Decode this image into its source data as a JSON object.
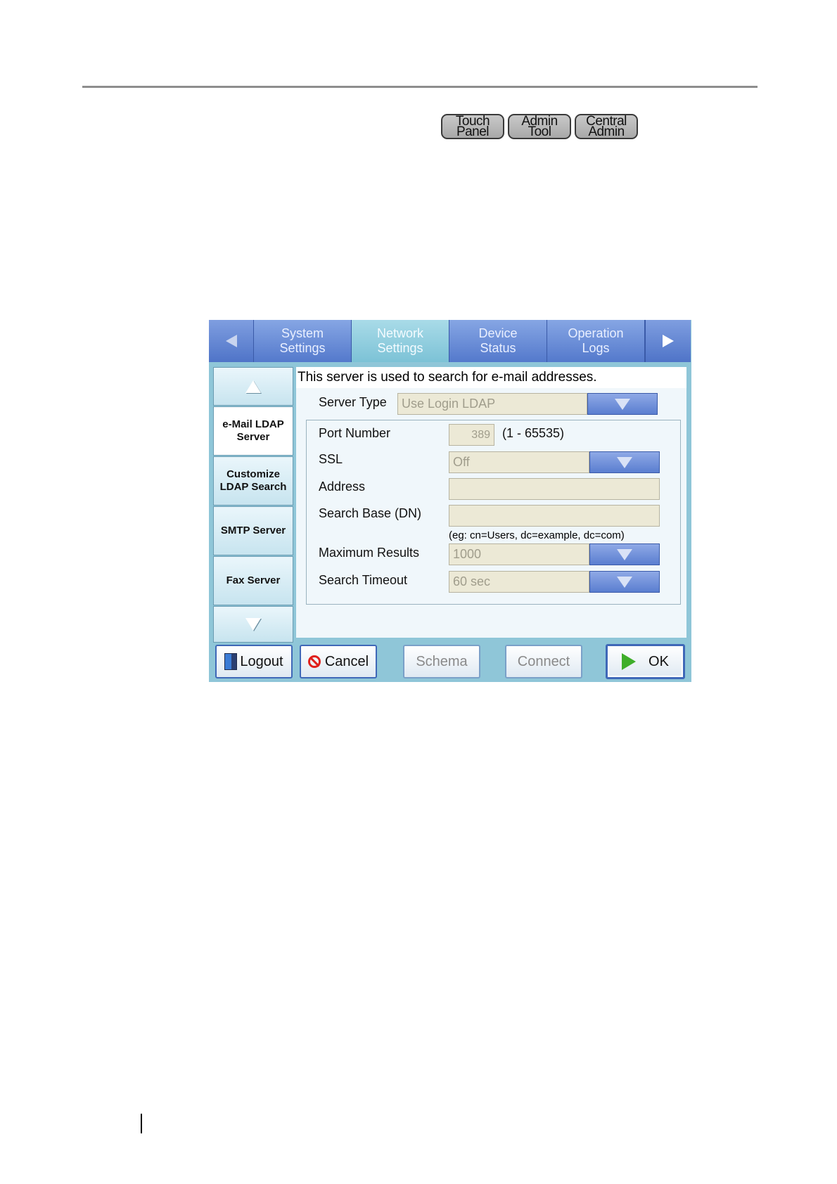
{
  "badges": [
    {
      "line1": "Touch",
      "line2": "Panel"
    },
    {
      "line1": "Admin",
      "line2": "Tool"
    },
    {
      "line1": "Central",
      "line2": "Admin"
    }
  ],
  "tabs": [
    {
      "line1": "System",
      "line2": "Settings",
      "active": false
    },
    {
      "line1": "Network",
      "line2": "Settings",
      "active": true
    },
    {
      "line1": "Device",
      "line2": "Status",
      "active": false
    },
    {
      "line1": "Operation",
      "line2": "Logs",
      "active": false
    }
  ],
  "sidebar": {
    "items": [
      {
        "label": "e-Mail LDAP Server",
        "line1": "e-Mail LDAP",
        "line2": "Server",
        "active": true
      },
      {
        "label": "Customize LDAP Search",
        "line1": "Customize",
        "line2": "LDAP Search",
        "active": false
      },
      {
        "label": "SMTP Server",
        "active": false
      },
      {
        "label": "Fax Server",
        "active": false
      }
    ]
  },
  "form": {
    "description": "This server is used to search for e-mail addresses.",
    "server_type": {
      "label": "Server Type",
      "value": "Use Login LDAP"
    },
    "port_number": {
      "label": "Port Number",
      "value": "389",
      "range": "(1 - 65535)"
    },
    "ssl": {
      "label": "SSL",
      "value": "Off"
    },
    "address": {
      "label": "Address",
      "value": ""
    },
    "search_base": {
      "label": "Search Base (DN)",
      "value": "",
      "hint": "(eg: cn=Users, dc=example, dc=com)"
    },
    "max_results": {
      "label": "Maximum Results",
      "value": "1000"
    },
    "search_timeout": {
      "label": "Search Timeout",
      "value": "60 sec"
    }
  },
  "footer": {
    "logout": "Logout",
    "cancel": "Cancel",
    "schema": "Schema",
    "connect": "Connect",
    "ok": "OK"
  },
  "colors": {
    "tab_blue": "#5479cc",
    "tab_active": "#7cc2d6",
    "panel_bg": "#8fc6d8",
    "field_bg": "#ece9d6"
  }
}
